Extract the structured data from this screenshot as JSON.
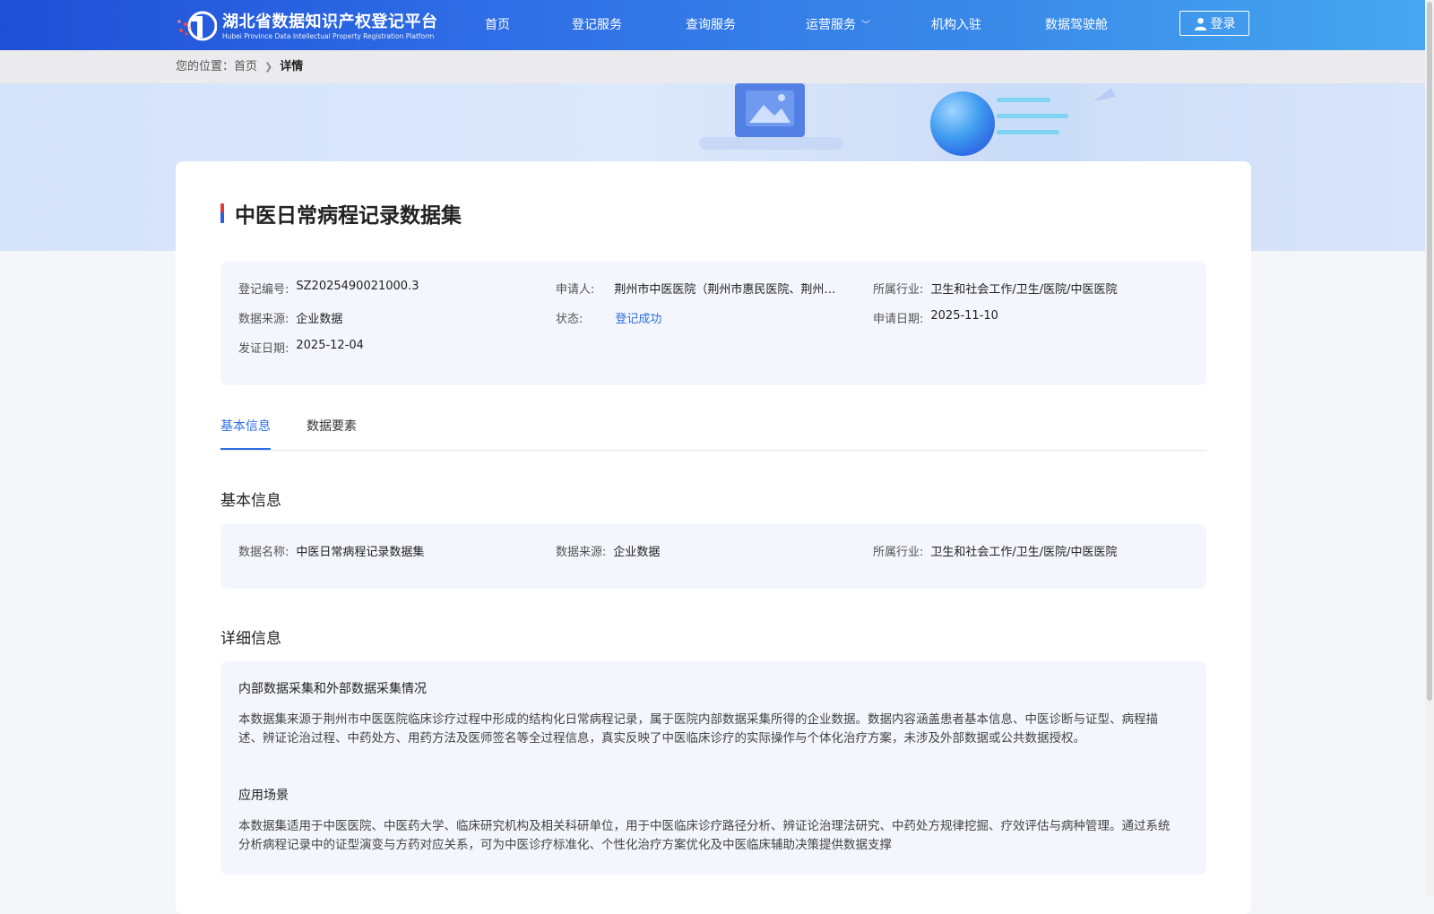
{
  "header": {
    "logo_cn": "湖北省数据知识产权登记平台",
    "logo_en": "Hubei Province Data Intellectual Property Registration Platform",
    "nav": [
      "首页",
      "登记服务",
      "查询服务",
      "运营服务",
      "机构入驻",
      "数据驾驶舱"
    ],
    "login_label": "登录"
  },
  "breadcrumb": {
    "prefix": "您的位置：",
    "home": "首页",
    "current": "详情"
  },
  "detail": {
    "title": "中医日常病程记录数据集",
    "info": [
      {
        "label": "登记编号:",
        "value": "SZ2025490021000.3"
      },
      {
        "label": "申请人:",
        "value": "荆州市中医医院（荆州市惠民医院、荆州…"
      },
      {
        "label": "所属行业:",
        "value": "卫生和社会工作/卫生/医院/中医医院"
      },
      {
        "label": "数据来源:",
        "value": "企业数据"
      },
      {
        "label": "状态:",
        "value": "登记成功"
      },
      {
        "label": "申请日期:",
        "value": "2025-11-10"
      },
      {
        "label": "发证日期:",
        "value": "2025-12-04"
      }
    ],
    "tabs": [
      "基本信息",
      "数据要素"
    ],
    "basic_title": "基本信息",
    "basic": [
      {
        "label": "数据名称:",
        "value": "中医日常病程记录数据集"
      },
      {
        "label": "数据来源:",
        "value": "企业数据"
      },
      {
        "label": "所属行业:",
        "value": "卫生和社会工作/卫生/医院/中医医院"
      }
    ],
    "detail_title": "详细信息",
    "sections": [
      {
        "heading": "内部数据采集和外部数据采集情况",
        "text": "本数据集来源于荆州市中医医院临床诊疗过程中形成的结构化日常病程记录，属于医院内部数据采集所得的企业数据。数据内容涵盖患者基本信息、中医诊断与证型、病程描述、辨证论治过程、中药处方、用药方法及医师签名等全过程信息，真实反映了中医临床诊疗的实际操作与个体化治疗方案，未涉及外部数据或公共数据授权。"
      },
      {
        "heading": "应用场景",
        "text": "本数据集适用于中医医院、中医药大学、临床研究机构及相关科研单位，用于中医临床诊疗路径分析、辨证论治理法研究、中药处方规律挖掘、疗效评估与病种管理。通过系统分析病程记录中的证型演变与方药对应关系，可为中医诊疗标准化、个性化治疗方案优化及中医临床辅助决策提供数据支撑"
      }
    ]
  },
  "colors": {
    "header_start": "#1f4fd6",
    "header_end": "#46a7f0",
    "accent": "#2f6ee6",
    "panel_bg": "#f3f6fc"
  },
  "icons": [
    "logo-icon",
    "chevron-down-icon",
    "user-icon",
    "chevron-right-icon"
  ]
}
